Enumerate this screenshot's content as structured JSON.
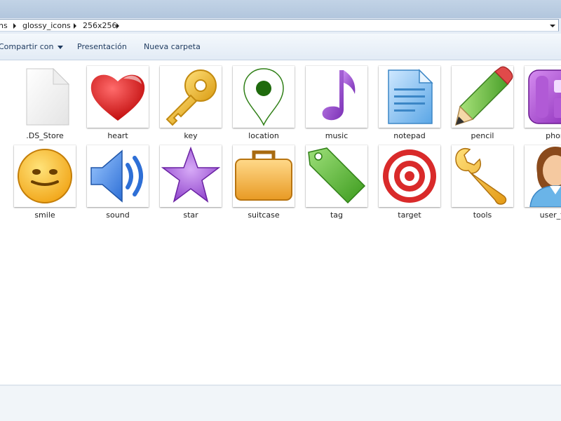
{
  "address": {
    "crumbs": [
      "ns",
      "glossy_icons",
      "256x256"
    ]
  },
  "toolbar": {
    "share_label": "Compartir con",
    "slideshow_label": "Presentación",
    "new_folder_label": "Nueva carpeta"
  },
  "files": {
    "row1": [
      ".DS_Store",
      "heart",
      "key",
      "location",
      "music",
      "notepad",
      "pencil",
      "phon"
    ],
    "row2": [
      "smile",
      "sound",
      "star",
      "suitcase",
      "tag",
      "target",
      "tools",
      "user_fer"
    ]
  },
  "colors": {
    "toolbar_text": "#1e3a5f",
    "window_frame": "#b2c6dd"
  }
}
